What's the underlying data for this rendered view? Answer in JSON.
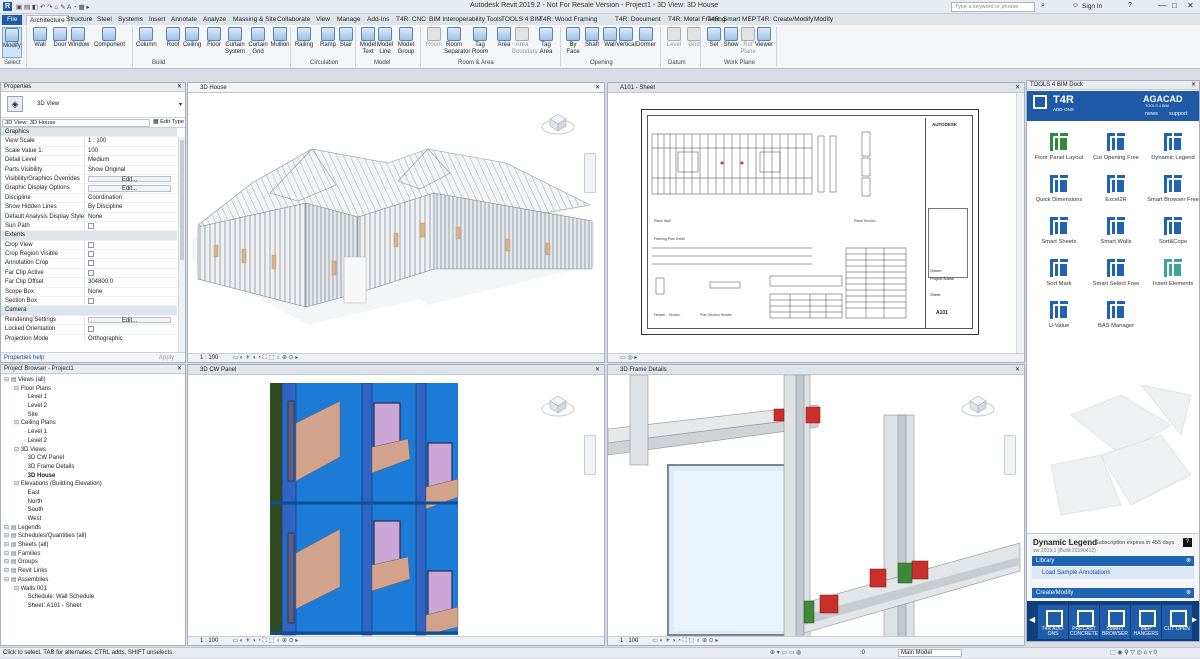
{
  "window": {
    "title": "Autodesk Revit 2019.2 - Not For Resale Version - Project1 - 3D View: 3D House",
    "search_placeholder": "Type a keyword or phrase",
    "sign_in": "Sign In"
  },
  "ribbon_tabs": [
    "File",
    "Architecture",
    "Structure",
    "Steel",
    "Systems",
    "Insert",
    "Annotate",
    "Analyze",
    "Massing & Site",
    "Collaborate",
    "View",
    "Manage",
    "Add-Ins",
    "T4R: CNC",
    "BIM Interoperability Tools",
    "TOOLS 4 BIM",
    "T4R: Wood Framing",
    "T4R: Document",
    "T4R: Metal Framing",
    "T4R: Smart MEP",
    "T4R: Create/Modify",
    "Modify"
  ],
  "ribbon": {
    "buttons": [
      {
        "label": "Modify"
      },
      {
        "label": "Wall"
      },
      {
        "label": "Door"
      },
      {
        "label": "Window"
      },
      {
        "label": "Component"
      },
      {
        "label": "Column"
      },
      {
        "label": "Roof"
      },
      {
        "label": "Ceiling"
      },
      {
        "label": "Floor"
      },
      {
        "label": "Curtain System"
      },
      {
        "label": "Curtain Grid"
      },
      {
        "label": "Mullion"
      },
      {
        "label": "Railing"
      },
      {
        "label": "Ramp"
      },
      {
        "label": "Stair"
      },
      {
        "label": "Model Text"
      },
      {
        "label": "Model Line"
      },
      {
        "label": "Model Group"
      },
      {
        "label": "Room"
      },
      {
        "label": "Room Separator"
      },
      {
        "label": "Tag Room"
      },
      {
        "label": "Area"
      },
      {
        "label": "Area Boundary"
      },
      {
        "label": "Tag Area"
      },
      {
        "label": "By Face"
      },
      {
        "label": "Shaft"
      },
      {
        "label": "Wall"
      },
      {
        "label": "Vertical"
      },
      {
        "label": "Dormer"
      },
      {
        "label": "Level"
      },
      {
        "label": "Grid"
      },
      {
        "label": "Set"
      },
      {
        "label": "Show"
      },
      {
        "label": "Ref Plane"
      },
      {
        "label": "Viewer"
      }
    ],
    "panels": [
      "Select",
      "Build",
      "Circulation",
      "Model",
      "Room & Area",
      "Opening",
      "Datum",
      "Work Plane"
    ]
  },
  "properties": {
    "title": "Properties",
    "type_name": "3D View",
    "selector": "3D View: 3D House",
    "edit_type": "Edit Type",
    "rows": [
      {
        "k": "Graphics",
        "group": true
      },
      {
        "k": "View Scale",
        "v": "1 : 100"
      },
      {
        "k": "Scale Value    1:",
        "v": "100"
      },
      {
        "k": "Detail Level",
        "v": "Medium"
      },
      {
        "k": "Parts Visibility",
        "v": "Show Original"
      },
      {
        "k": "Visibility/Graphics Overrides",
        "btn": "Edit..."
      },
      {
        "k": "Graphic Display Options",
        "btn": "Edit..."
      },
      {
        "k": "Discipline",
        "v": "Coordination"
      },
      {
        "k": "Show Hidden Lines",
        "v": "By Discipline"
      },
      {
        "k": "Default Analysis Display Style",
        "v": "None"
      },
      {
        "k": "Sun Path",
        "chk": true
      },
      {
        "k": "Extents",
        "group": true
      },
      {
        "k": "Crop View",
        "chk": true
      },
      {
        "k": "Crop Region Visible",
        "chk": true
      },
      {
        "k": "Annotation Crop",
        "chk": true
      },
      {
        "k": "Far Clip Active",
        "chk": true
      },
      {
        "k": "Far Clip Offset",
        "v": "304800.0"
      },
      {
        "k": "Scope Box",
        "v": "None"
      },
      {
        "k": "Section Box",
        "chk": true
      },
      {
        "k": "Camera",
        "group": true
      },
      {
        "k": "Rendering Settings",
        "btn": "Edit..."
      },
      {
        "k": "Locked Orientation",
        "chk": true
      },
      {
        "k": "Projection Mode",
        "v": "Orthographic"
      }
    ],
    "help": "Properties help",
    "apply": "Apply"
  },
  "project_browser": {
    "title": "Project Browser - Project1",
    "items": [
      {
        "d": 0,
        "t": "Views (all)"
      },
      {
        "d": 1,
        "t": "Floor Plans"
      },
      {
        "d": 2,
        "t": "Level 1"
      },
      {
        "d": 2,
        "t": "Level 2"
      },
      {
        "d": 2,
        "t": "Site"
      },
      {
        "d": 1,
        "t": "Ceiling Plans"
      },
      {
        "d": 2,
        "t": "Level 1"
      },
      {
        "d": 2,
        "t": "Level 2"
      },
      {
        "d": 1,
        "t": "3D Views"
      },
      {
        "d": 2,
        "t": "3D CW Panel"
      },
      {
        "d": 2,
        "t": "3D Frame Details"
      },
      {
        "d": 2,
        "t": "3D House",
        "b": true
      },
      {
        "d": 1,
        "t": "Elevations (Building Elevation)"
      },
      {
        "d": 2,
        "t": "East"
      },
      {
        "d": 2,
        "t": "North"
      },
      {
        "d": 2,
        "t": "South"
      },
      {
        "d": 2,
        "t": "West"
      },
      {
        "d": 0,
        "t": "Legends"
      },
      {
        "d": 0,
        "t": "Schedules/Quantities (all)"
      },
      {
        "d": 0,
        "t": "Sheets (all)"
      },
      {
        "d": 0,
        "t": "Families"
      },
      {
        "d": 0,
        "t": "Groups"
      },
      {
        "d": 0,
        "t": "Revit Links"
      },
      {
        "d": 0,
        "t": "Assemblies"
      },
      {
        "d": 1,
        "t": "Walls 001"
      },
      {
        "d": 2,
        "t": "Schedule: Wall Schedule"
      },
      {
        "d": 2,
        "t": "Sheet: A101 - Sheet"
      }
    ]
  },
  "views": {
    "house": {
      "title": "3D House",
      "scale": "1 : 100"
    },
    "sheet": {
      "title": "A101 - Sheet",
      "brand": "AUTODESK",
      "sheet_no": "A101",
      "name": "Sheet",
      "project": "Project Name",
      "unnamed": "Unnamed",
      "owner": "Owner"
    },
    "cw": {
      "title": "3D CW Panel",
      "scale": "1 : 100"
    },
    "frame": {
      "title": "3D Frame Details",
      "scale": "1 : 100"
    }
  },
  "dock": {
    "title": "TOOLS 4 BIM Dock",
    "t4r": "T4R",
    "t4r_sub": "ADD-ONS",
    "agacad": "AGACAD",
    "agacad_sub": "TOOLS 4 BIM",
    "links": [
      "news",
      "support"
    ],
    "tools": [
      "Floor Panel Layout",
      "Cut Opening Free",
      "Dynamic Legend",
      "Quick Dimensions",
      "Excel2R",
      "Smart Browser Free",
      "Smart Sheets",
      "Smart Walls",
      "Sort&Cope",
      "Sort Mark",
      "Smart Select Free",
      "Insert Elements",
      "U-Value",
      "BAS Manager"
    ],
    "legend_title": "Dynamic Legend",
    "subscription": "Subscription expires in 455 days",
    "version": "ver.2019.1 (Build 20190412)",
    "library": "Library",
    "load_sample": "Load Sample Annotations",
    "create_modify": "Create/Modify",
    "bottom_tiles": [
      "T4R ADD-ONS",
      "PRECAST CONCRETE",
      "SMART BROWSER",
      "MEP HANGERS",
      "CUT OPEN"
    ]
  },
  "status": {
    "hint": "Click to select, TAB for alternates, CTRL adds, SHIFT unselects.",
    "model": "Main Model",
    "zero": ":0"
  },
  "colors": {
    "accent": "#1f5aa6",
    "panel_blue": "#1f63b3",
    "selection": "#cfe3f8"
  }
}
